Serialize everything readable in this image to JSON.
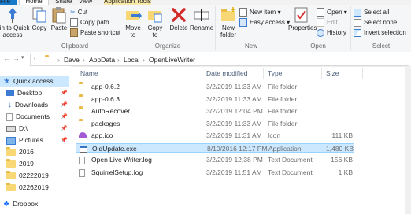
{
  "tabs": {
    "file": "File",
    "home": "Home",
    "share": "Share",
    "view": "View",
    "app_tools": "Application Tools"
  },
  "ribbon": {
    "clipboard": {
      "label": "Clipboard",
      "pin_quick_access": "Pin to Quick access",
      "copy": "Copy",
      "paste": "Paste",
      "cut": "Cut",
      "copy_path": "Copy path",
      "paste_shortcut": "Paste shortcut"
    },
    "organize": {
      "label": "Organize",
      "move_to": "Move to",
      "copy_to": "Copy to",
      "delete": "Delete",
      "rename": "Rename"
    },
    "new": {
      "label": "New",
      "new_folder": "New folder",
      "new_item": "New item",
      "easy_access": "Easy access"
    },
    "open": {
      "label": "Open",
      "properties": "Properties",
      "open": "Open",
      "edit": "Edit",
      "history": "History"
    },
    "select": {
      "label": "Select",
      "select_all": "Select all",
      "select_none": "Select none",
      "invert_selection": "Invert selection"
    }
  },
  "breadcrumb": [
    "Dave",
    "AppData",
    "Local",
    "OpenLiveWriter"
  ],
  "nav": {
    "quick_access": "Quick access",
    "items": [
      "Desktop",
      "Downloads",
      "Documents",
      "D:\\",
      "Pictures",
      "2016",
      "2019",
      "02222019",
      "02262019"
    ],
    "dropbox": "Dropbox"
  },
  "columns": {
    "name": "Name",
    "date": "Date modified",
    "type": "Type",
    "size": "Size"
  },
  "files": [
    {
      "name": "app-0.6.2",
      "date": "3/2/2019 11:33 AM",
      "type": "File folder",
      "size": "",
      "icon": "folder"
    },
    {
      "name": "app-0.6.3",
      "date": "3/2/2019 11:33 AM",
      "type": "File folder",
      "size": "",
      "icon": "folder"
    },
    {
      "name": "AutoRecover",
      "date": "3/2/2019 12:04 PM",
      "type": "File folder",
      "size": "",
      "icon": "folder"
    },
    {
      "name": "packages",
      "date": "3/2/2019 11:33 AM",
      "type": "File folder",
      "size": "",
      "icon": "folder"
    },
    {
      "name": "app.ico",
      "date": "3/2/2019 11:31 AM",
      "type": "Icon",
      "size": "111 KB",
      "icon": "ico"
    },
    {
      "name": "OldUpdate.exe",
      "date": "8/10/2016 12:17 PM",
      "type": "Application",
      "size": "1,480 KB",
      "icon": "app"
    },
    {
      "name": "Open Live Writer.log",
      "date": "3/2/2019 12:38 PM",
      "type": "Text Document",
      "size": "156 KB",
      "icon": "file"
    },
    {
      "name": "SquirrelSetup.log",
      "date": "3/2/2019 11:51 AM",
      "type": "Text Document",
      "size": "1 KB",
      "icon": "file"
    }
  ]
}
